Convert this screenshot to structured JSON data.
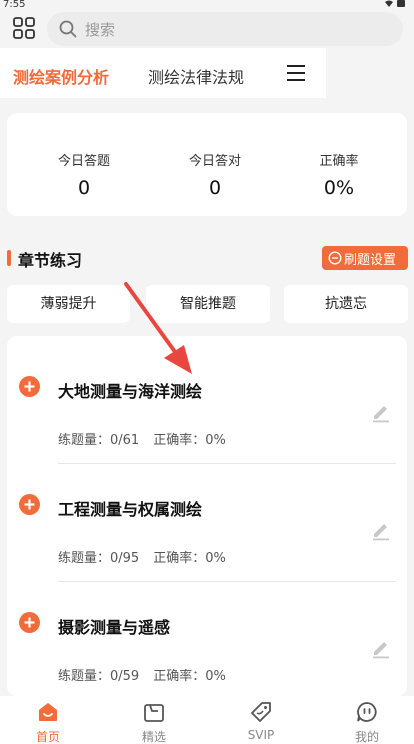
{
  "status_bar": {
    "time": "7:55"
  },
  "search": {
    "placeholder": "搜索"
  },
  "tabs": [
    {
      "label": "测绘案例分析",
      "active": true
    },
    {
      "label": "测绘法律法规",
      "active": false
    }
  ],
  "stats": [
    {
      "label": "今日答题",
      "value": "0"
    },
    {
      "label": "今日答对",
      "value": "0"
    },
    {
      "label": "正确率",
      "value": "0%"
    }
  ],
  "section": {
    "title": "章节练习",
    "settings_label": "刷题设置"
  },
  "practice_buttons": [
    "薄弱提升",
    "智能推题",
    "抗遗忘"
  ],
  "chapters": [
    {
      "title": "大地测量与海洋测绘",
      "count_label": "练题量：0/61",
      "rate_label": "正确率：0%"
    },
    {
      "title": "工程测量与权属测绘",
      "count_label": "练题量：0/95",
      "rate_label": "正确率：0%"
    },
    {
      "title": "摄影测量与遥感",
      "count_label": "练题量：0/59",
      "rate_label": "正确率：0%"
    }
  ],
  "bottom_nav": [
    {
      "label": "首页",
      "icon": "home-icon",
      "active": true
    },
    {
      "label": "精选",
      "icon": "featured-icon",
      "active": false
    },
    {
      "label": "SVIP",
      "icon": "svip-tag-icon",
      "active": false
    },
    {
      "label": "我的",
      "icon": "profile-icon",
      "active": false
    }
  ],
  "colors": {
    "accent": "#f26b3a",
    "background": "#f4f4f4",
    "card": "#ffffff"
  }
}
